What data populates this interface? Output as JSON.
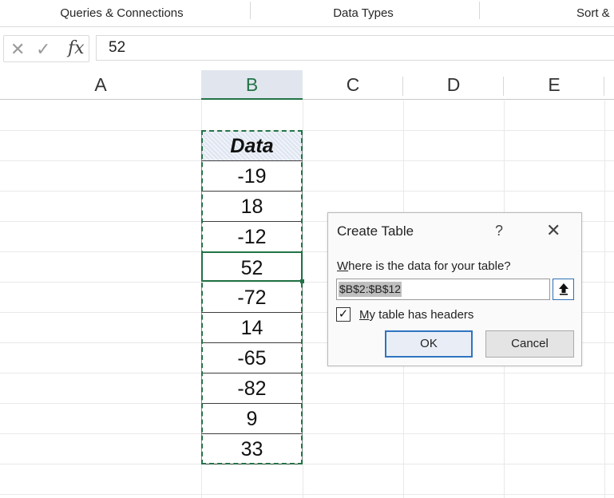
{
  "ribbon": {
    "groups": [
      "Queries & Connections",
      "Data Types",
      "Sort &"
    ]
  },
  "formula_bar": {
    "cancel_icon": "x-icon",
    "enter_icon": "check-icon",
    "fx_label": "fx",
    "value": "52"
  },
  "columns": [
    "A",
    "B",
    "C",
    "D",
    "E"
  ],
  "selected_column": "B",
  "table": {
    "header": "Data",
    "values": [
      "-19",
      "18",
      "-12",
      "52",
      "-72",
      "14",
      "-65",
      "-82",
      "9",
      "33"
    ],
    "active_value": "52"
  },
  "dialog": {
    "title": "Create Table",
    "help_label": "?",
    "close_label": "✕",
    "prompt_prefix": "W",
    "prompt_rest": "here is the data for your table?",
    "range_value": "$B$2:$B$12",
    "collapse_icon": "up-arrow-icon",
    "checkbox_checked": true,
    "checkbox_mark": "✓",
    "checkbox_label_prefix": "M",
    "checkbox_label_rest": "y table has headers",
    "ok_label": "OK",
    "cancel_label": "Cancel"
  },
  "colors": {
    "accent_green": "#217346",
    "selected_header_bg": "#e1e6ee",
    "ok_border": "#2f74c0"
  }
}
